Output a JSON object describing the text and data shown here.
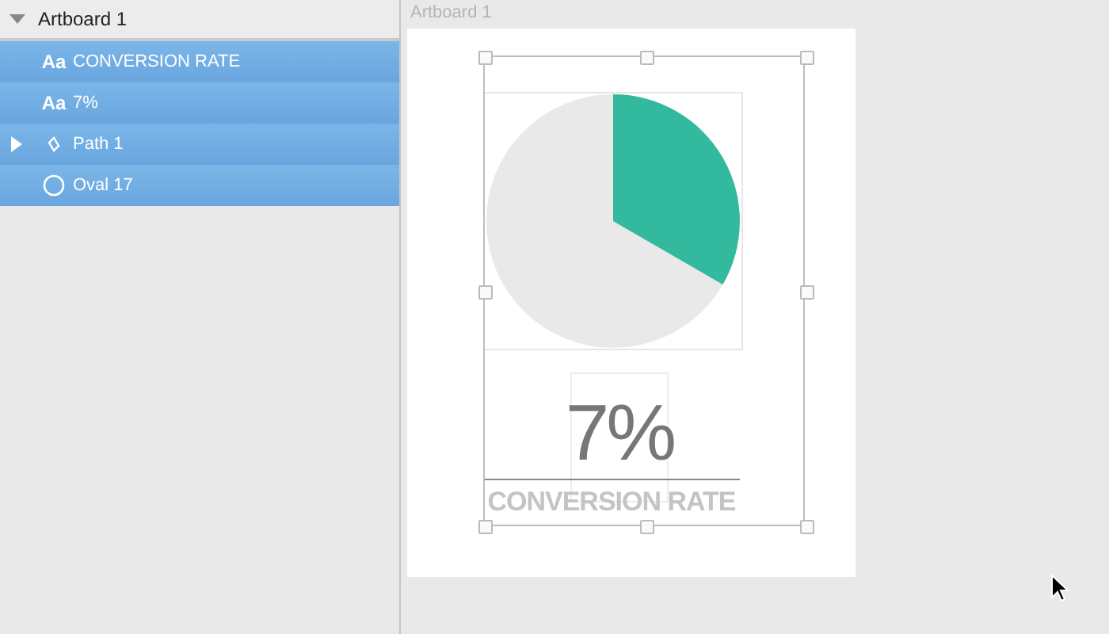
{
  "layers": {
    "title": "Artboard 1",
    "expanded": true,
    "items": [
      {
        "kind": "text",
        "icon_text": "Aa",
        "name": "CONVERSION RATE",
        "selected": true
      },
      {
        "kind": "text",
        "icon_text": "Aa",
        "name": "7%",
        "selected": true
      },
      {
        "kind": "path",
        "name": "Path 1",
        "selected": true,
        "expanded": false
      },
      {
        "kind": "oval",
        "name": "Oval 17",
        "selected": true
      }
    ]
  },
  "canvas": {
    "artboard_label": "Artboard 1",
    "value": "7%",
    "caption": "CONVERSION RATE"
  }
}
